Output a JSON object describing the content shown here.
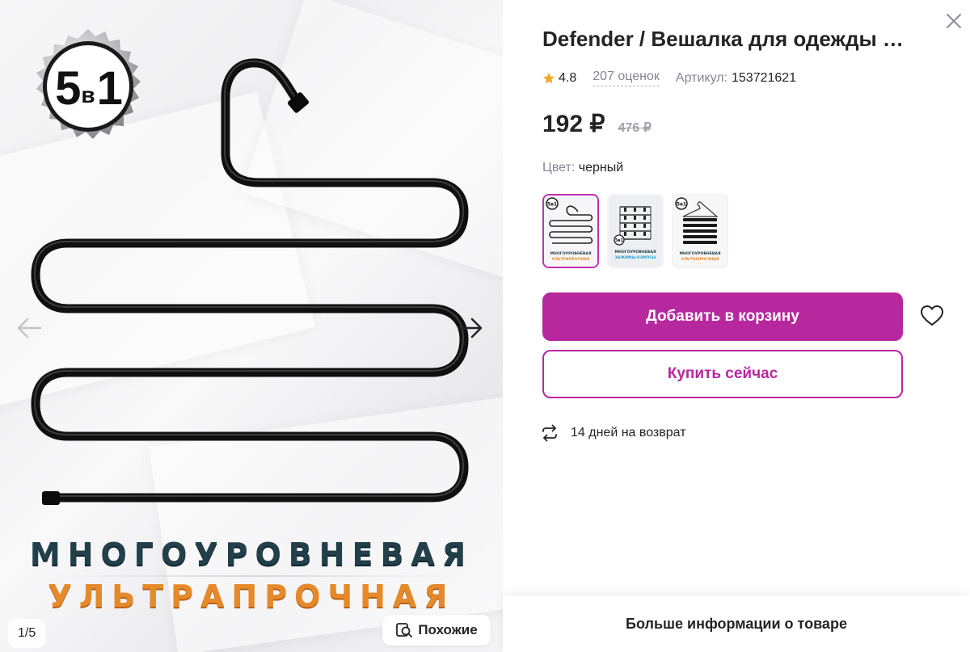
{
  "gallery": {
    "badge_big_left": "5",
    "badge_small": "в",
    "badge_big_right": "1",
    "promo_line_1": "МНОГОУРОВНЕВАЯ",
    "promo_line_2": "УЛЬТРАПРОЧНАЯ",
    "counter": "1/5",
    "similar_label": "Похожие",
    "prev_icon": "arrow-left-icon",
    "next_icon": "arrow-right-icon",
    "similar_icon": "search-similar-icon"
  },
  "product": {
    "title": "Defender / Вешалка для одежды …",
    "rating": "4.8",
    "reviews": "207 оценок",
    "article_label": "Артикул:",
    "article_value": "153721621",
    "price_current": "192 ₽",
    "price_old": "476 ₽",
    "color_label": "Цвет:",
    "color_value": "черный",
    "variants": [
      {
        "caption_top": "МНОГОУРОВНЕВАЯ",
        "caption_bottom": "УЛЬТРАПРОЧНАЯ",
        "badge": "5в1",
        "active": true
      },
      {
        "caption_top": "МНОГОУРОВНЕВАЯ",
        "caption_bottom": "ЗАЖИМЫ-КЛИПСЫ",
        "badge": "5в1",
        "active": false
      },
      {
        "caption_top": "МНОГОУРОВНЕВАЯ",
        "caption_bottom": "УЛЬТРАПРОЧНАЯ",
        "badge": "5в1",
        "active": false
      }
    ]
  },
  "actions": {
    "add_to_cart": "Добавить в корзину",
    "buy_now": "Купить сейчас",
    "return_policy": "14 дней на возврат",
    "more_info": "Больше информации о товаре"
  },
  "colors": {
    "accent": "#b7289f",
    "accent_border": "#c030b5",
    "muted_text": "#868695",
    "star": "#f5a623",
    "promo_dark": "#23404a",
    "promo_orange": "#e58a2a"
  }
}
